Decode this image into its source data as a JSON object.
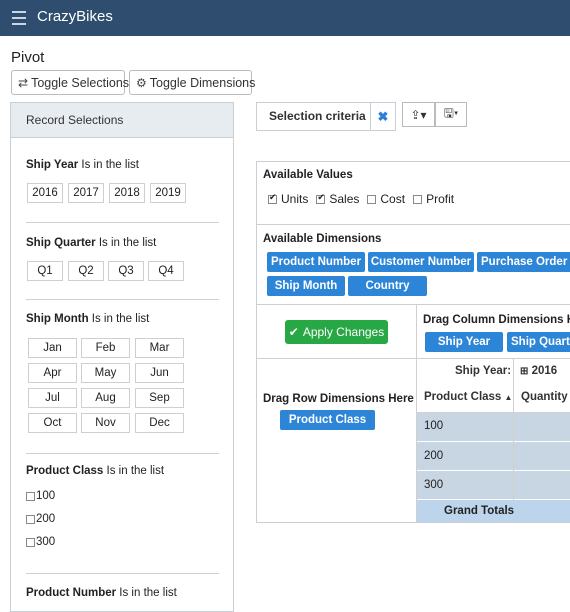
{
  "app": {
    "brand": "CrazyBikes",
    "menu_icon": "hamburger-icon"
  },
  "page": {
    "title": "Pivot"
  },
  "toolbar": {
    "toggle_selections": {
      "label": "Toggle Selections",
      "icon": "exchange-icon"
    },
    "toggle_dimensions": {
      "label": "Toggle Dimensions",
      "icon": "gears-icon"
    }
  },
  "selections": {
    "title": "Record Selections",
    "ship_year": {
      "field": "Ship Year",
      "condition": "Is in the list",
      "options": [
        "2016",
        "2017",
        "2018",
        "2019"
      ]
    },
    "ship_quarter": {
      "field": "Ship Quarter",
      "condition": "Is in the list",
      "options": [
        "Q1",
        "Q2",
        "Q3",
        "Q4"
      ]
    },
    "ship_month": {
      "field": "Ship Month",
      "condition": "Is in the list",
      "options": [
        "Jan",
        "Feb",
        "Mar",
        "Apr",
        "May",
        "Jun",
        "Jul",
        "Aug",
        "Sep",
        "Oct",
        "Nov",
        "Dec"
      ]
    },
    "product_class": {
      "field": "Product Class",
      "condition": "Is in the list",
      "options": [
        "100",
        "200",
        "300"
      ]
    },
    "product_number": {
      "field": "Product Number",
      "condition": "Is in the list"
    }
  },
  "criteria": {
    "label": "Selection criteria",
    "clear_icon": "close-icon",
    "export_icon": "share-icon",
    "save_icon": "save-icon"
  },
  "pivot": {
    "available_values": {
      "title": "Available Values",
      "items": [
        {
          "label": "Units",
          "checked": true
        },
        {
          "label": "Sales",
          "checked": true
        },
        {
          "label": "Cost",
          "checked": false
        },
        {
          "label": "Profit",
          "checked": false
        }
      ]
    },
    "available_dimensions": {
      "title": "Available Dimensions",
      "items": [
        "Product Number",
        "Customer Number",
        "Purchase Order #",
        "Ship Month",
        "Country"
      ]
    },
    "apply_label": "Apply Changes",
    "column_drop": {
      "label": "Drag Column Dimensions Here",
      "items": [
        "Ship Year",
        "Ship Quarter"
      ]
    },
    "row_drop": {
      "label": "Drag Row Dimensions Here",
      "items": [
        "Product Class"
      ]
    },
    "table": {
      "ship_year_label": "Ship Year:",
      "year_value": "2016",
      "row_header": "Product Class",
      "measure_header": "Quantity",
      "rows": [
        "100",
        "200",
        "300"
      ],
      "grand_totals": "Grand Totals"
    }
  }
}
